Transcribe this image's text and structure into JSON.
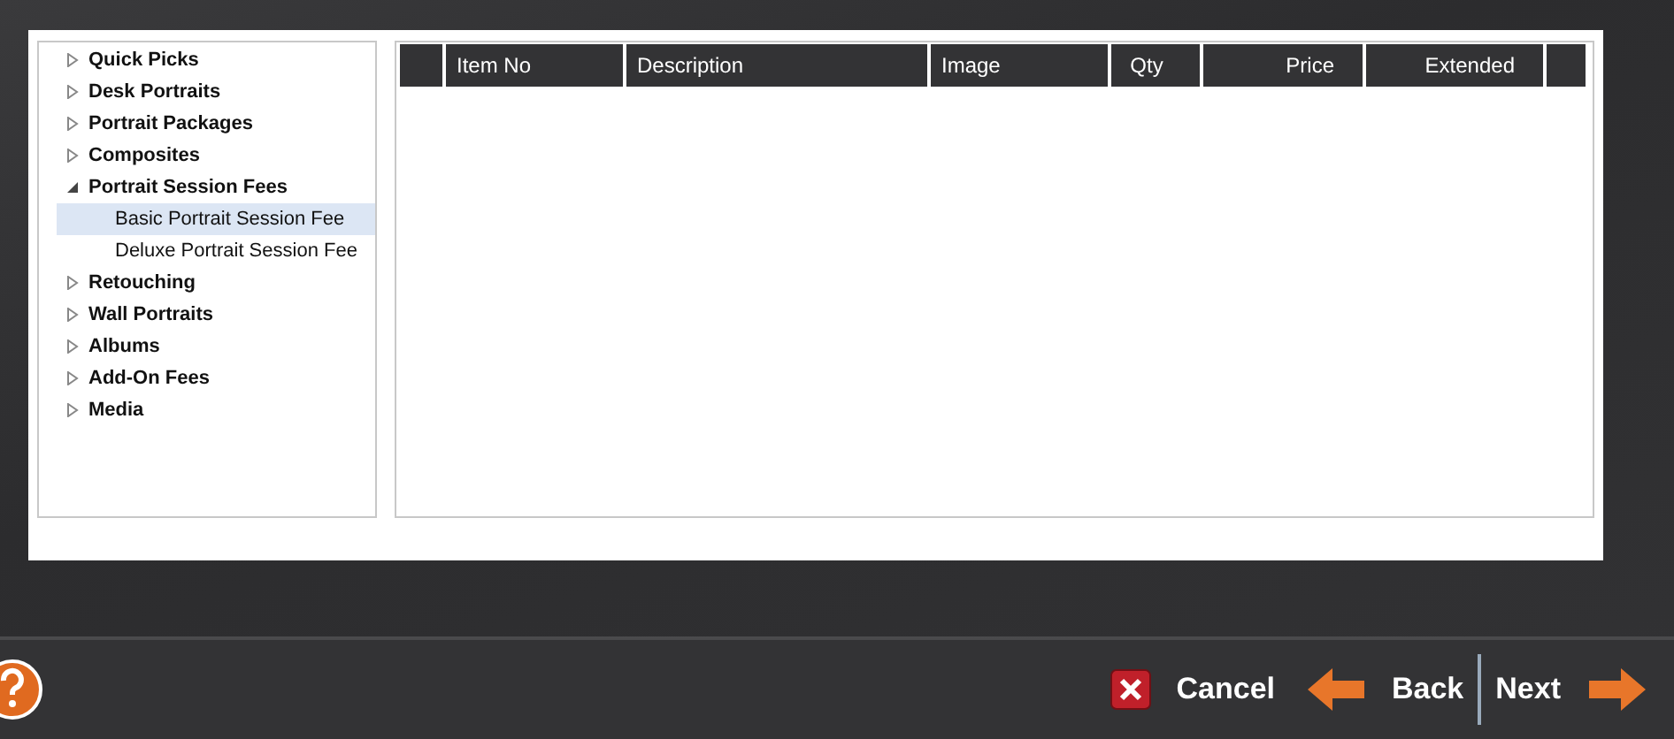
{
  "tree": [
    {
      "label": "Quick Picks",
      "expanded": false,
      "selected": false
    },
    {
      "label": "Desk Portraits",
      "expanded": false,
      "selected": false
    },
    {
      "label": "Portrait Packages",
      "expanded": false,
      "selected": false
    },
    {
      "label": "Composites",
      "expanded": false,
      "selected": false
    },
    {
      "label": "Portrait Session Fees",
      "expanded": true,
      "selected": false,
      "children": [
        {
          "label": "Basic Portrait Session Fee",
          "selected": true
        },
        {
          "label": "Deluxe Portrait Session Fee",
          "selected": false
        }
      ]
    },
    {
      "label": "Retouching",
      "expanded": false,
      "selected": false
    },
    {
      "label": "Wall Portraits",
      "expanded": false,
      "selected": false
    },
    {
      "label": "Albums",
      "expanded": false,
      "selected": false
    },
    {
      "label": "Add-On Fees",
      "expanded": false,
      "selected": false
    },
    {
      "label": "Media",
      "expanded": false,
      "selected": false
    }
  ],
  "table": {
    "columns": [
      "Item No",
      "Description",
      "Image",
      "Qty",
      "Price",
      "Extended"
    ]
  },
  "footer": {
    "buttons": [
      {
        "kind": "cancel",
        "label": "Cancel"
      },
      {
        "kind": "back",
        "label": "Back"
      },
      {
        "kind": "next",
        "label": "Next"
      }
    ]
  }
}
